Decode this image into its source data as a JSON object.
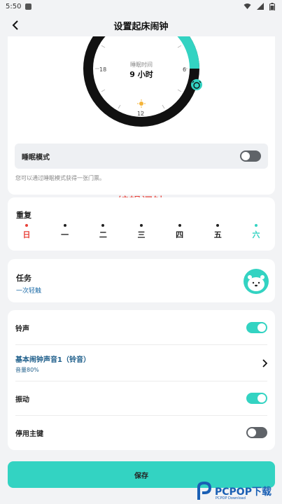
{
  "status_bar": {
    "time": "5:50"
  },
  "header": {
    "title": "设置起床闹钟"
  },
  "clock": {
    "caption": "睡眠时间",
    "duration": "9 小时",
    "ticks": {
      "top": "",
      "left": "18",
      "right": "6",
      "bottom": "12"
    },
    "accent_color": "#33d3c2",
    "ring_color": "#111111"
  },
  "sleep_mode": {
    "label": "睡眠模式",
    "enabled": false,
    "note": "您可以通过睡眠模式获得一张门票。"
  },
  "overlay": {
    "text": "编辑闹钟"
  },
  "repeat": {
    "label": "重复",
    "days": [
      "日",
      "一",
      "二",
      "三",
      "四",
      "五",
      "六"
    ]
  },
  "task": {
    "label": "任务",
    "value": "一次轻触"
  },
  "ringtone": {
    "label": "铃声",
    "enabled": true,
    "sound_name": "基本闹钟声音1（铃音）",
    "volume": "音量80%"
  },
  "vibration": {
    "label": "振动",
    "enabled": true
  },
  "disable_home": {
    "label": "停用主键",
    "enabled": false
  },
  "save": {
    "label": "保存"
  },
  "watermark": {
    "brand": "PCPOP下载",
    "sub": "PCPOP Download"
  },
  "colors": {
    "accent": "#33d3c2",
    "sunday": "#e8423a",
    "link": "#1f6da8"
  }
}
